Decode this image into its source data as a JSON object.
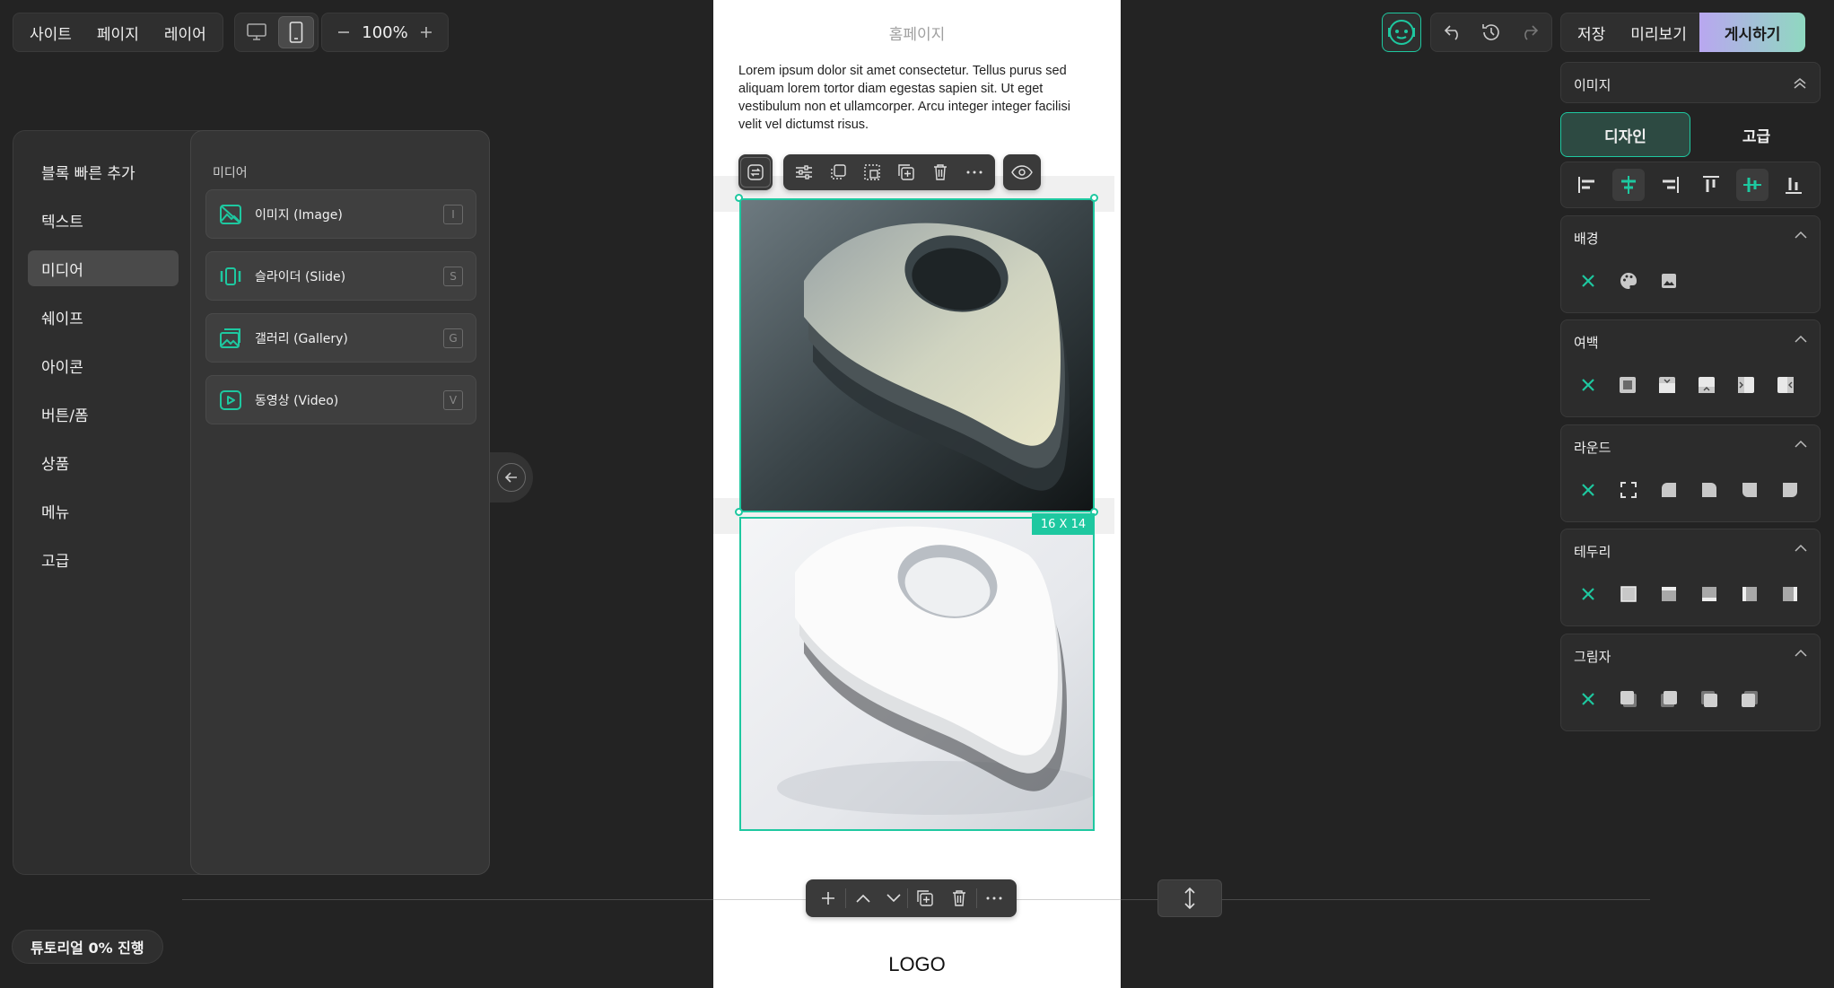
{
  "topnav": {
    "site": "사이트",
    "page": "페이지",
    "layer": "레이어"
  },
  "zoom": {
    "value": "100%"
  },
  "left_panel": {
    "categories": [
      "블록 빠른 추가",
      "텍스트",
      "미디어",
      "쉐이프",
      "아이콘",
      "버튼/폼",
      "상품",
      "메뉴",
      "고급"
    ],
    "active_category": "미디어",
    "section_title": "미디어",
    "media_items": [
      {
        "label": "이미지 (Image)",
        "key": "I",
        "icon": "image-icon"
      },
      {
        "label": "슬라이더 (Slide)",
        "key": "S",
        "icon": "slider-icon"
      },
      {
        "label": "갤러리 (Gallery)",
        "key": "G",
        "icon": "gallery-icon"
      },
      {
        "label": "동영상 (Video)",
        "key": "V",
        "icon": "video-icon"
      }
    ]
  },
  "tutorial": {
    "label": "튜토리얼 0% 진행",
    "progress": 0
  },
  "canvas": {
    "page_title": "홈페이지",
    "body_text": "Lorem ipsum dolor sit amet consectetur. Tellus purus sed aliquam lorem tortor diam egestas sapien sit. Ut eget vestibulum non et ullamcorper. Arcu integer integer facilisi velit vel dictumst risus.",
    "size_badge": "16 X 14",
    "footer_logo": "LOGO"
  },
  "top_actions": {
    "save": "저장",
    "preview": "미리보기",
    "publish": "게시하기"
  },
  "right_panel": {
    "panel_title": "이미지",
    "tabs": {
      "design": "디자인",
      "advanced": "고급"
    },
    "sections": {
      "background": "배경",
      "spacing": "여백",
      "round": "라운드",
      "border": "테두리",
      "shadow": "그림자"
    }
  },
  "colors": {
    "accent": "#1ec8a0",
    "background": "#232323",
    "panel": "#2e2e2e",
    "publish_gradient_start": "#b9a7f0",
    "publish_gradient_end": "#8fd8c0"
  }
}
